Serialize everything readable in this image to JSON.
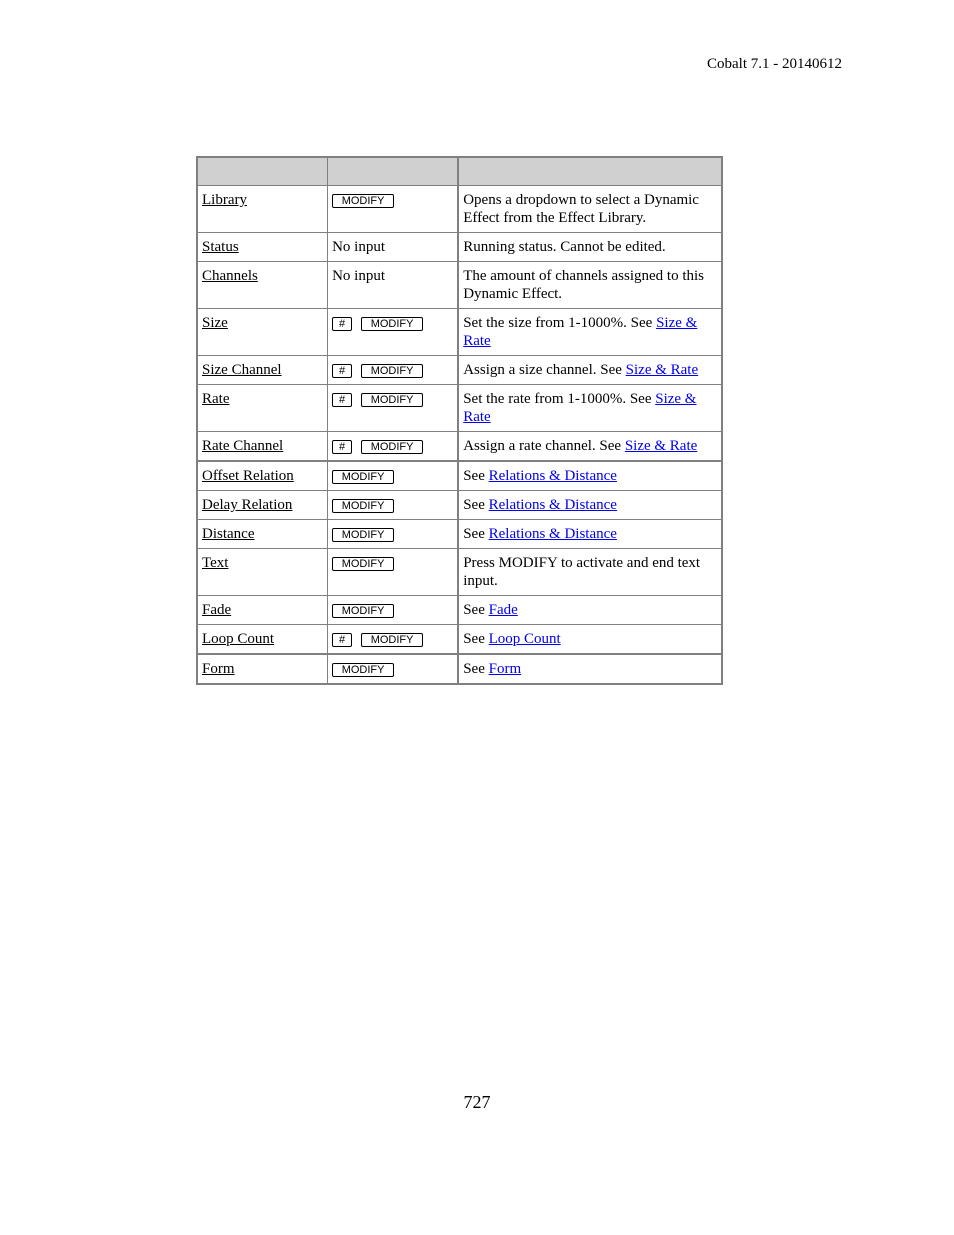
{
  "header": {
    "text": "Cobalt 7.1 - 20140612"
  },
  "table": {
    "headers": [
      "",
      "",
      ""
    ],
    "rows": [
      {
        "name": "Library",
        "keys": [
          "MODIFY"
        ],
        "desc": "Opens a dropdown to select a Dynamic Effect from the Effect Library.",
        "link": ""
      },
      {
        "name": "Status",
        "keys": [],
        "input_text": "No input",
        "desc": "Running status. Cannot be edited.",
        "link": ""
      },
      {
        "name": "Channels",
        "keys": [],
        "input_text": "No input",
        "desc": "The amount of channels assigned to this Dynamic Effect.",
        "link": ""
      },
      {
        "name": "Size",
        "keys": [
          "#",
          "MODIFY"
        ],
        "desc": "Set the size from 1-1000%. See ",
        "link": "Size & Rate"
      },
      {
        "name": "Size Channel",
        "keys": [
          "#",
          "MODIFY"
        ],
        "desc": "Assign a size channel. See ",
        "link": "Size & Rate"
      },
      {
        "name": "Rate",
        "keys": [
          "#",
          "MODIFY"
        ],
        "desc": "Set the rate from 1-1000%. See ",
        "link": "Size & Rate"
      },
      {
        "name": "Rate Channel",
        "keys": [
          "#",
          "MODIFY"
        ],
        "desc": "Assign a rate channel. See ",
        "link": "Size & Rate"
      },
      {
        "name": "Offset Relation",
        "keys": [
          "MODIFY"
        ],
        "desc": "See ",
        "link": "Relations & Distance",
        "group_break": true
      },
      {
        "name": "Delay Relation",
        "keys": [
          "MODIFY"
        ],
        "desc": "See ",
        "link": "Relations & Distance"
      },
      {
        "name": "Distance",
        "keys": [
          "MODIFY"
        ],
        "desc": "See ",
        "link": "Relations & Distance"
      },
      {
        "name": "Text",
        "keys": [
          "MODIFY"
        ],
        "desc": "Press MODIFY to activate and end text input.",
        "link": ""
      },
      {
        "name": "Fade",
        "keys": [
          "MODIFY"
        ],
        "desc": "See ",
        "link": "Fade"
      },
      {
        "name": "Loop Count",
        "keys": [
          "#",
          "MODIFY"
        ],
        "desc": "See ",
        "link": "Loop Count"
      },
      {
        "name": "Form",
        "keys": [
          "MODIFY"
        ],
        "desc": "See ",
        "link": "Form",
        "group_break": true
      }
    ]
  },
  "footer": {
    "page_number": "727"
  }
}
